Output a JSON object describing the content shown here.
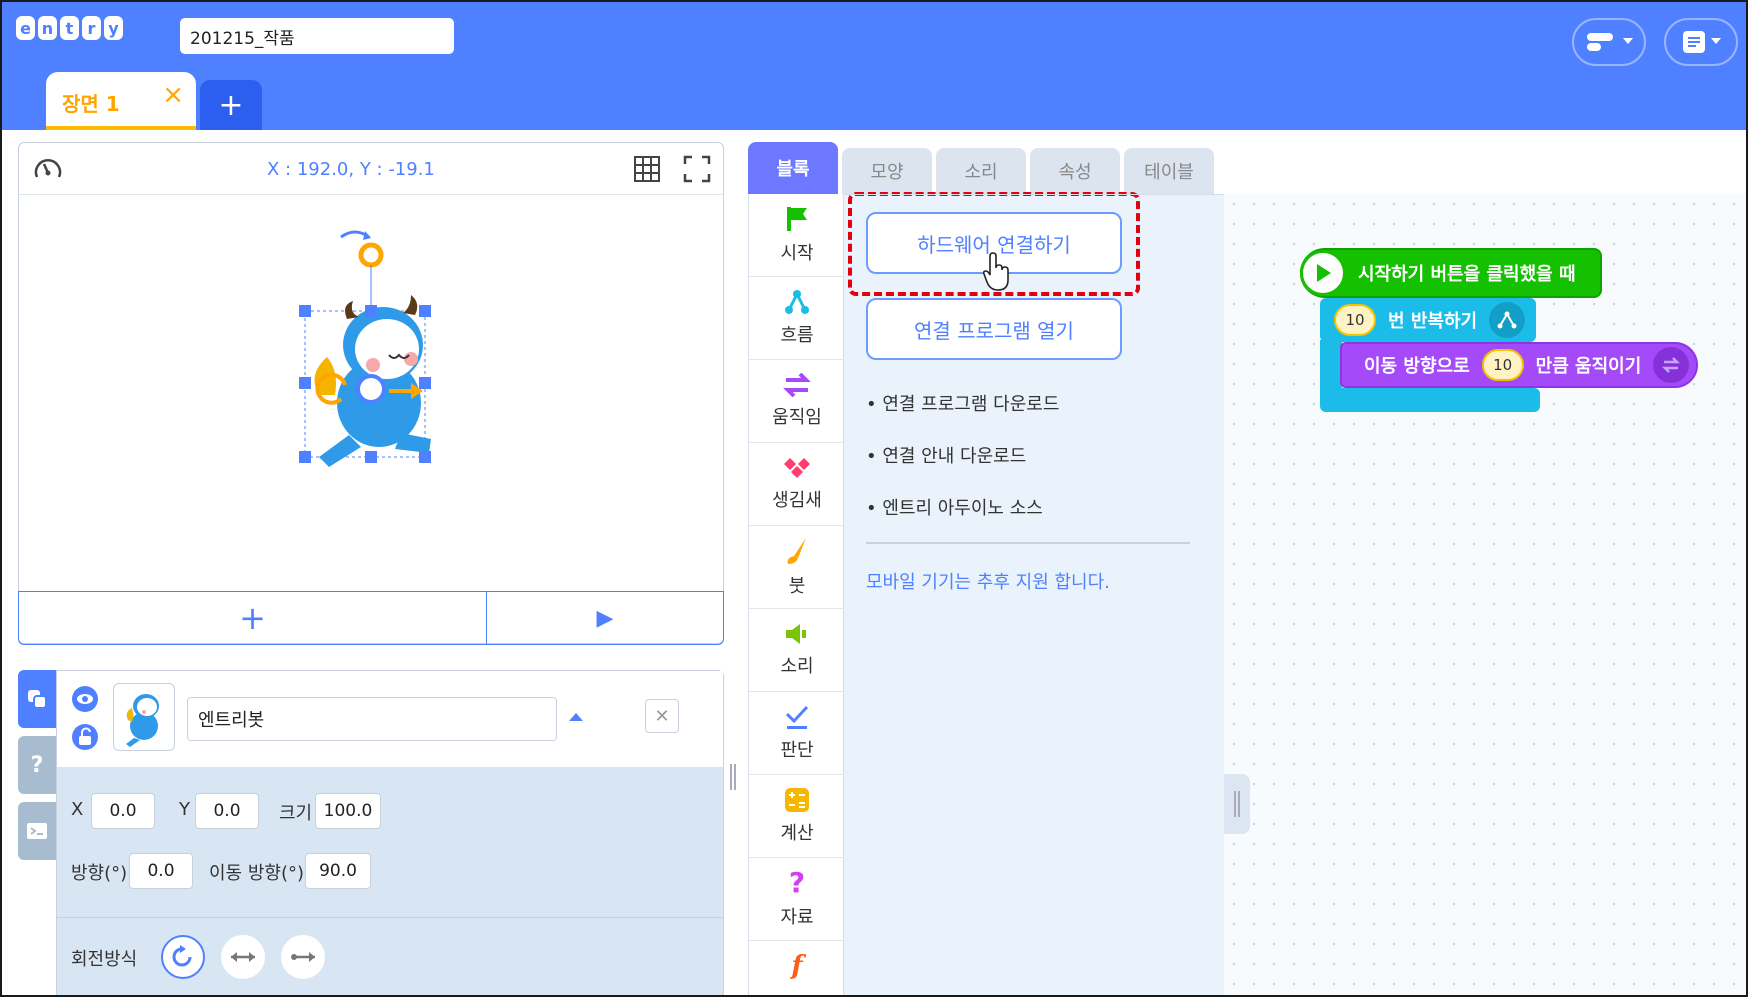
{
  "header": {
    "logo_letters": [
      "e",
      "n",
      "t",
      "r",
      "y"
    ],
    "project_title": "201215_작품",
    "scene_tab_label": "장면 1",
    "scene_tab_close": "×",
    "add_scene": "+"
  },
  "stage": {
    "coords": "X : 192.0, Y : -19.1",
    "add_object": "+",
    "run": "▶"
  },
  "object": {
    "name": "엔트리봇",
    "x_label": "X",
    "x_value": "0.0",
    "y_label": "Y",
    "y_value": "0.0",
    "size_label": "크기",
    "size_value": "100.0",
    "direction_label": "방향(°)",
    "direction_value": "0.0",
    "move_direction_label": "이동 방향(°)",
    "move_direction_value": "90.0",
    "rotation_label": "회전방식",
    "close": "✕"
  },
  "tabs": [
    "블록",
    "모양",
    "소리",
    "속성",
    "테이블"
  ],
  "categories": [
    {
      "label": "시작",
      "icon": "flag-icon",
      "color": "#14c000"
    },
    {
      "label": "흐름",
      "icon": "flow-icon",
      "color": "#1bbde8"
    },
    {
      "label": "움직임",
      "icon": "move-icon",
      "color": "#a44af8"
    },
    {
      "label": "생김새",
      "icon": "looks-icon",
      "color": "#ff3d6e"
    },
    {
      "label": "붓",
      "icon": "brush-icon",
      "color": "#ffa500"
    },
    {
      "label": "소리",
      "icon": "speaker-icon",
      "color": "#7cc40a"
    },
    {
      "label": "판단",
      "icon": "check-icon",
      "color": "#4f80ff"
    },
    {
      "label": "계산",
      "icon": "calc-icon",
      "color": "#f5b700"
    },
    {
      "label": "자료",
      "icon": "question-icon",
      "color": "#d63cf2"
    },
    {
      "label": "",
      "icon": "function-icon",
      "color": "#ff5c1a"
    }
  ],
  "hardware": {
    "connect_button": "하드웨어 연결하기",
    "open_program_button": "연결 프로그램 열기",
    "downloads": [
      "연결 프로그램 다운로드",
      "연결 안내 다운로드",
      "엔트리 아두이노 소스"
    ],
    "mobile_note": "모바일 기기는 추후 지원 합니다."
  },
  "code": {
    "start_block": "시작하기 버튼을 클릭했을 때",
    "repeat_count": "10",
    "repeat_label": "번 반복하기",
    "move_prefix": "이동 방향으로",
    "move_count": "10",
    "move_suffix": "만큼 움직이기"
  },
  "colors": {
    "brand_blue": "#4f80ff",
    "highlight_red": "#e00010",
    "scene_orange": "#ffa500"
  }
}
